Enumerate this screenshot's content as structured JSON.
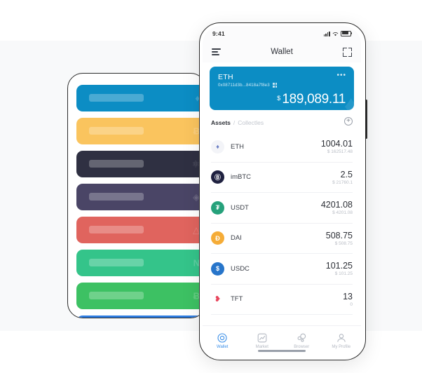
{
  "background": {
    "page_color": "#ffffff",
    "band_color": "#f8f9fa"
  },
  "back_phone": {
    "name": "skeleton-wallet-list",
    "cards": [
      {
        "token": "ETH",
        "glyph": "♦",
        "color": "#0c8dc4"
      },
      {
        "token": "BTC",
        "glyph": "Ƀ",
        "color": "#fac45e"
      },
      {
        "token": "ATOM",
        "glyph": "⚛",
        "color": "#2f3042"
      },
      {
        "token": "EOS",
        "glyph": "◈",
        "color": "#4a4566"
      },
      {
        "token": "TRX",
        "glyph": "△",
        "color": "#e0645e"
      },
      {
        "token": "NEO",
        "glyph": "N",
        "color": "#34c48a"
      },
      {
        "token": "BCH",
        "glyph": "Ƀ",
        "color": "#3dc163"
      },
      {
        "token": "LTC",
        "glyph": "Ł",
        "color": "#2f7de1"
      }
    ]
  },
  "front_phone": {
    "status_bar": {
      "time": "9:41",
      "signal_icon": "signal-bars-icon",
      "wifi_icon": "wifi-icon",
      "battery_icon": "battery-icon"
    },
    "nav_bar": {
      "menu_icon": "hamburger-menu-icon",
      "title": "Wallet",
      "scan_icon": "scan-qr-icon"
    },
    "wallet_card": {
      "name": "ETH",
      "address": "0x08711d3b...8418a7f8e3",
      "qr_icon": "qr-code-icon",
      "more_icon": "more-options-icon",
      "more_glyph": "•••",
      "currency_symbol": "$",
      "balance": "189,089.11",
      "watermark_glyph": "♦",
      "background_color": "#0c8dc4"
    },
    "tabs": {
      "assets_label": "Assets",
      "separator": "/",
      "collectibles_label": "Collectles",
      "add_button_glyph": "+"
    },
    "assets": [
      {
        "symbol": "ETH",
        "amount": "1004.01",
        "fiat": "$ 162517.48",
        "icon_name": "eth-token-icon",
        "icon_glyph": "♦",
        "icon_bg": "#f3f4f8",
        "icon_fg": "#6b7ec4"
      },
      {
        "symbol": "imBTC",
        "amount": "2.5",
        "fiat": "$ 21760.1",
        "icon_name": "imbtc-token-icon",
        "icon_glyph": "Ⓑ",
        "icon_bg": "#1f2140",
        "icon_fg": "#ffffff"
      },
      {
        "symbol": "USDT",
        "amount": "4201.08",
        "fiat": "$ 4201.08",
        "icon_name": "usdt-token-icon",
        "icon_glyph": "₮",
        "icon_bg": "#26a17b",
        "icon_fg": "#ffffff"
      },
      {
        "symbol": "DAI",
        "amount": "508.75",
        "fiat": "$ 508.75",
        "icon_name": "dai-token-icon",
        "icon_glyph": "Đ",
        "icon_bg": "#f5ac37",
        "icon_fg": "#ffffff"
      },
      {
        "symbol": "USDC",
        "amount": "101.25",
        "fiat": "$ 101.25",
        "icon_name": "usdc-token-icon",
        "icon_glyph": "$",
        "icon_bg": "#2775ca",
        "icon_fg": "#ffffff"
      },
      {
        "symbol": "TFT",
        "amount": "13",
        "fiat": "0",
        "icon_name": "tft-token-icon",
        "icon_glyph": "❥",
        "icon_bg": "#ffffff",
        "icon_fg": "#e8455c"
      }
    ],
    "tab_bar": {
      "active_color": "#3b8fe8",
      "inactive_color": "#b4b9c2",
      "items": [
        {
          "label": "Wallet",
          "icon": "wallet-tab-icon",
          "active": true
        },
        {
          "label": "Market",
          "icon": "market-tab-icon",
          "active": false
        },
        {
          "label": "Browser",
          "icon": "browser-tab-icon",
          "active": false
        },
        {
          "label": "My Profile",
          "icon": "profile-tab-icon",
          "active": false
        }
      ]
    }
  }
}
